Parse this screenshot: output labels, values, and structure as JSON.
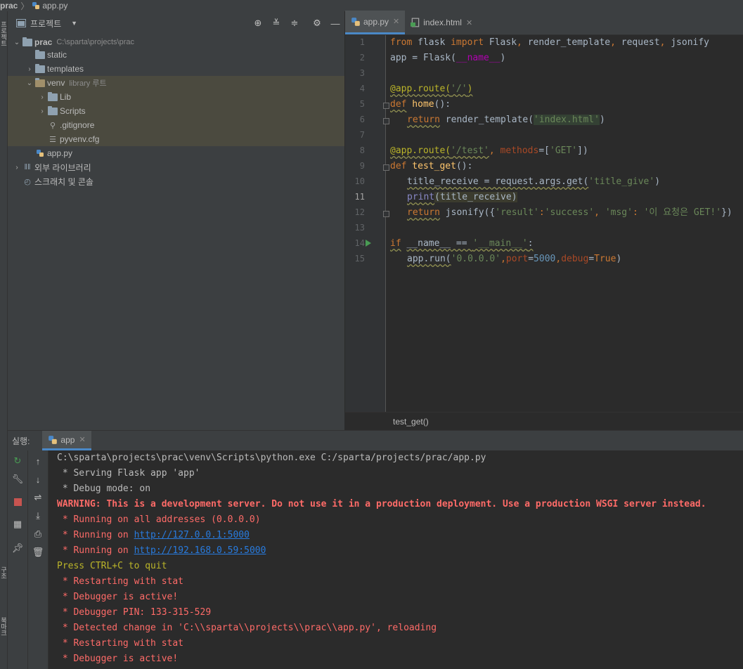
{
  "breadcrumb": {
    "project": "prac",
    "file": "app.py"
  },
  "left_stripe": {
    "labels": [
      "프로젝트",
      "구조",
      "북마크"
    ]
  },
  "project_panel": {
    "title": "프로젝트",
    "tree": [
      {
        "label": "prac",
        "path": "C:\\sparta\\projects\\prac"
      },
      {
        "label": "static"
      },
      {
        "label": "templates"
      },
      {
        "label": "venv",
        "path": "library 루트"
      },
      {
        "label": "Lib"
      },
      {
        "label": "Scripts"
      },
      {
        "label": ".gitignore"
      },
      {
        "label": "pyvenv.cfg"
      },
      {
        "label": "app.py"
      },
      {
        "label": "외부 라이브러리"
      },
      {
        "label": "스크래치 및 콘솔"
      }
    ]
  },
  "editor": {
    "tabs": [
      {
        "label": "app.py",
        "active": true
      },
      {
        "label": "index.html",
        "active": false
      }
    ],
    "line_numbers": [
      "1",
      "2",
      "3",
      "4",
      "5",
      "6",
      "7",
      "8",
      "9",
      "10",
      "11",
      "12",
      "13",
      "14",
      "15"
    ],
    "current_line": "11",
    "code": {
      "l1": {
        "from": "from",
        "mod": " flask ",
        "import": "import",
        "names": " Flask",
        "c1": ",",
        "n2": " render_template",
        "c2": ",",
        "n3": " request",
        "c3": ",",
        "n4": " jsonify"
      },
      "l2": {
        "text": "app = Flask(",
        "dunder": "__name__",
        "end": ")"
      },
      "l4": {
        "dec": "@app.route(",
        "str": "'/'",
        "end": ")"
      },
      "l5": {
        "kw": "def",
        "fn": " home",
        "rest": "():"
      },
      "l6": {
        "kw": "return",
        "call": " render_template(",
        "str": "'index.html'",
        "end": ")"
      },
      "l8": {
        "dec": "@app.route(",
        "str": "'/test'",
        "comma": ", ",
        "param": "methods",
        "eq": "=[",
        "str2": "'GET'",
        "end": "])"
      },
      "l9": {
        "kw": "def",
        "fn": " test_get",
        "rest": "():"
      },
      "l10": {
        "text": "title_receive = request.args.get(",
        "str": "'title_give'",
        "end": ")"
      },
      "l11": {
        "bi": "print",
        "rest": "(title_receive)"
      },
      "l12": {
        "kw": "return",
        "call": " jsonify({",
        "s1": "'result'",
        "colon1": ":",
        "s2": "'success'",
        "comma": ", ",
        "s3": "'msg'",
        "colon2": ": ",
        "s4": "'이 요청은 GET!'",
        "end": "})"
      },
      "l14": {
        "kw": "if",
        "sp": " ",
        "dunder": "__name__",
        "eq": " == ",
        "str": "'__main__'",
        "colon": ":"
      },
      "l15": {
        "call": "app.run(",
        "str": "'0.0.0.0'",
        "c1": ",",
        "p1": "port",
        "eq1": "=",
        "num": "5000",
        "c2": ",",
        "p2": "debug",
        "eq2": "=",
        "kw": "True",
        "end": ")"
      }
    },
    "footer_breadcrumb": "test_get()"
  },
  "run_panel": {
    "label": "실행:",
    "tab": "app",
    "console": [
      {
        "text": "C:\\sparta\\projects\\prac\\venv\\Scripts\\python.exe C:/sparta/projects/prac/app.py",
        "style": "norm"
      },
      {
        "text": " * Serving Flask app 'app'",
        "style": "norm"
      },
      {
        "text": " * Debug mode: on",
        "style": "norm"
      },
      {
        "text": "WARNING: This is a development server. Do not use it in a production deployment. Use a production WSGI server instead.",
        "style": "warn"
      },
      {
        "text": " * Running on all addresses (0.0.0.0)",
        "style": "err"
      },
      {
        "text": " * Running on ",
        "link": "http://127.0.0.1:5000",
        "style": "err"
      },
      {
        "text": " * Running on ",
        "link": "http://192.168.0.59:5000",
        "style": "err"
      },
      {
        "text": "Press CTRL+C to quit",
        "style": "yellow"
      },
      {
        "text": " * Restarting with stat",
        "style": "err"
      },
      {
        "text": " * Debugger is active!",
        "style": "err"
      },
      {
        "text": " * Debugger PIN: 133-315-529",
        "style": "err"
      },
      {
        "text": " * Detected change in 'C:\\\\sparta\\\\projects\\\\prac\\\\app.py', reloading",
        "style": "err"
      },
      {
        "text": " * Restarting with stat",
        "style": "err"
      },
      {
        "text": " * Debugger is active!",
        "style": "err"
      }
    ]
  },
  "colors": {
    "accent": "#4a88c7",
    "error": "#ff6b68",
    "string": "#6a8759",
    "keyword": "#cc7832"
  }
}
